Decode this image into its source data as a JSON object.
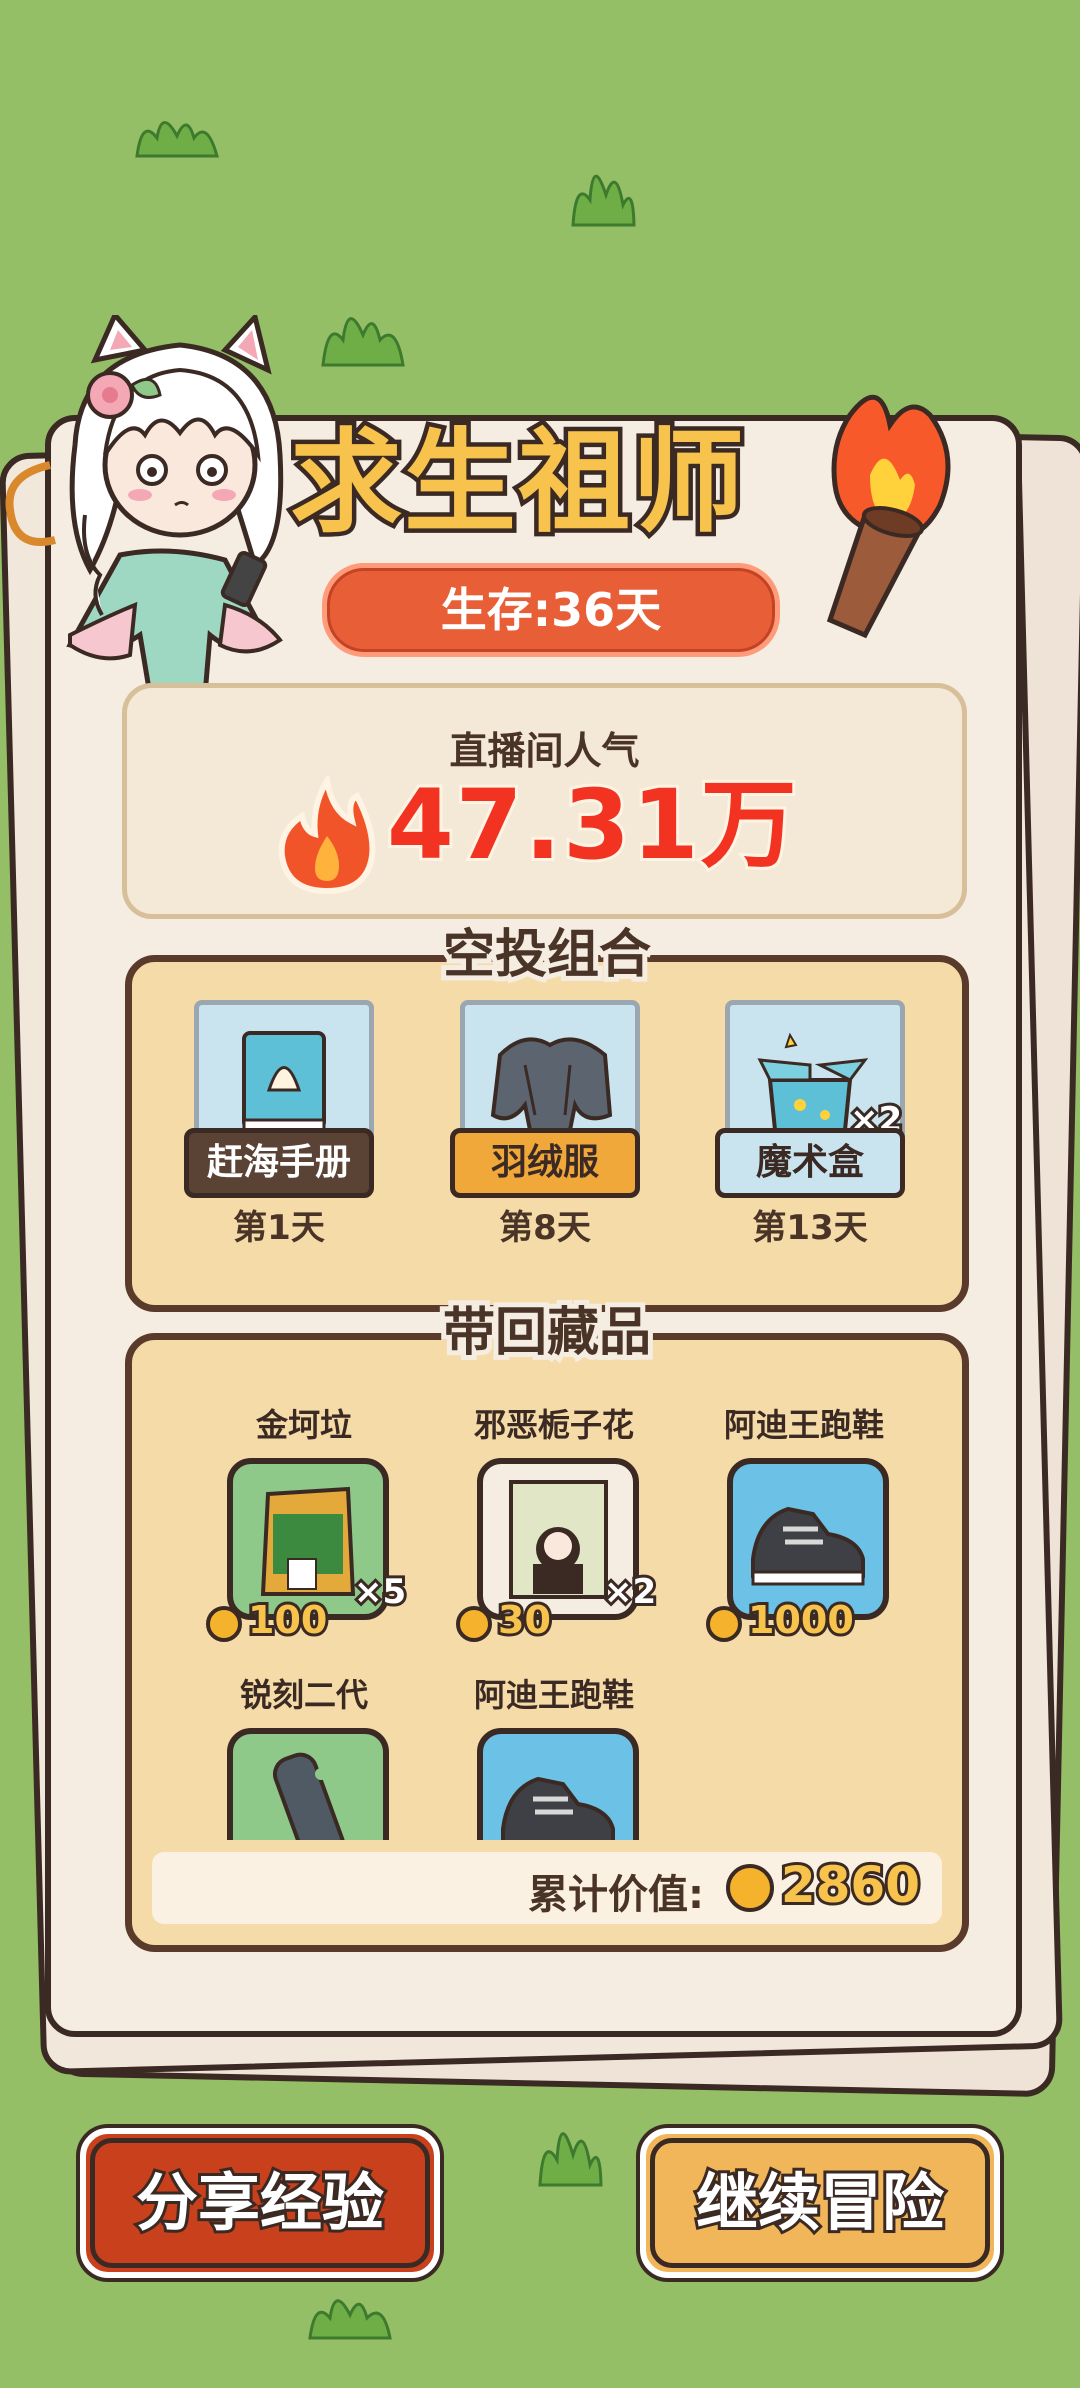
{
  "header": {
    "title": "求生祖师",
    "survival": "生存:36天"
  },
  "popularity": {
    "label": "直播间人气",
    "value": "47.31万"
  },
  "airdrop": {
    "title": "空投组合",
    "items": [
      {
        "name": "赶海手册",
        "day": "第1天"
      },
      {
        "name": "羽绒服",
        "day": "第8天"
      },
      {
        "name": "魔术盒",
        "day": "第13天",
        "count": "×2"
      }
    ]
  },
  "collection": {
    "title": "带回藏品",
    "items": [
      {
        "name": "金坷垃",
        "count": "×5",
        "price": "100"
      },
      {
        "name": "邪恶栀子花",
        "count": "×2",
        "price": "30"
      },
      {
        "name": "阿迪王跑鞋",
        "price": "1000"
      },
      {
        "name": "锐刻二代"
      },
      {
        "name": "阿迪王跑鞋"
      }
    ],
    "total_label": "累计价值:",
    "total_value": "2860"
  },
  "buttons": {
    "share": "分享经验",
    "continue": "继续冒险"
  },
  "colors": {
    "background": "#94bf66",
    "accent_red": "#e85e36",
    "gold": "#f7c34d"
  }
}
